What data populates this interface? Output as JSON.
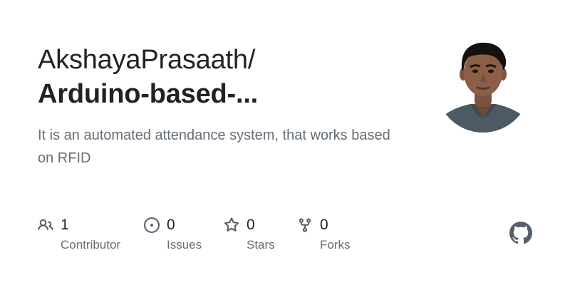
{
  "repo": {
    "owner": "AkshayaPrasaath/",
    "name": "Arduino-based-...",
    "description": "It is an automated attendance system, that works based on RFID"
  },
  "stats": [
    {
      "value": "1",
      "label": "Contributor",
      "icon": "contributors-icon"
    },
    {
      "value": "0",
      "label": "Issues",
      "icon": "issue-opened-icon"
    },
    {
      "value": "0",
      "label": "Stars",
      "icon": "star-icon"
    },
    {
      "value": "0",
      "label": "Forks",
      "icon": "repo-forked-icon"
    }
  ],
  "logo": {
    "icon": "github-mark-icon",
    "color": "#57606a"
  },
  "colors": {
    "text": "#1f2328",
    "muted": "#656d76",
    "icon": "#57606a"
  }
}
